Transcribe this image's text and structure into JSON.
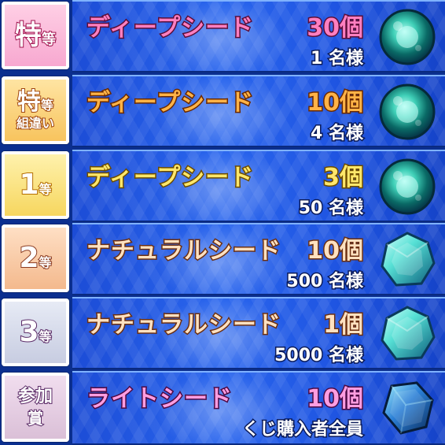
{
  "prizes": [
    {
      "rank_main": "特",
      "rank_sub": "等",
      "rank_sub2": "",
      "item_name": "ディープシード",
      "count": "30個",
      "winners": "1 名様",
      "icon": "deep-seed-orb-icon",
      "accent": "#ff7fc0"
    },
    {
      "rank_main": "特",
      "rank_sub": "等",
      "rank_sub2": "組違い",
      "item_name": "ディープシード",
      "count": "10個",
      "winners": "4 名様",
      "icon": "deep-seed-orb-icon",
      "accent": "#ffb347"
    },
    {
      "rank_main": "1",
      "rank_sub": "等",
      "rank_sub2": "",
      "item_name": "ディープシード",
      "count": "3個",
      "winners": "50 名様",
      "icon": "deep-seed-orb-icon",
      "accent": "#ffe76a"
    },
    {
      "rank_main": "2",
      "rank_sub": "等",
      "rank_sub2": "",
      "item_name": "ナチュラルシード",
      "count": "10個",
      "winners": "500 名様",
      "icon": "natural-seed-gem-icon",
      "accent": "#ffe1c0"
    },
    {
      "rank_main": "3",
      "rank_sub": "等",
      "rank_sub2": "",
      "item_name": "ナチュラルシード",
      "count": "1個",
      "winners": "5000 名様",
      "icon": "natural-seed-gem-icon",
      "accent": "#ffe1c0"
    },
    {
      "rank_main": "参加",
      "rank_sub": "賞",
      "rank_sub2": "",
      "item_name": "ライトシード",
      "count": "10個",
      "winners": "くじ購入者全員",
      "icon": "light-seed-crystal-icon",
      "accent": "#ff9de1"
    }
  ]
}
